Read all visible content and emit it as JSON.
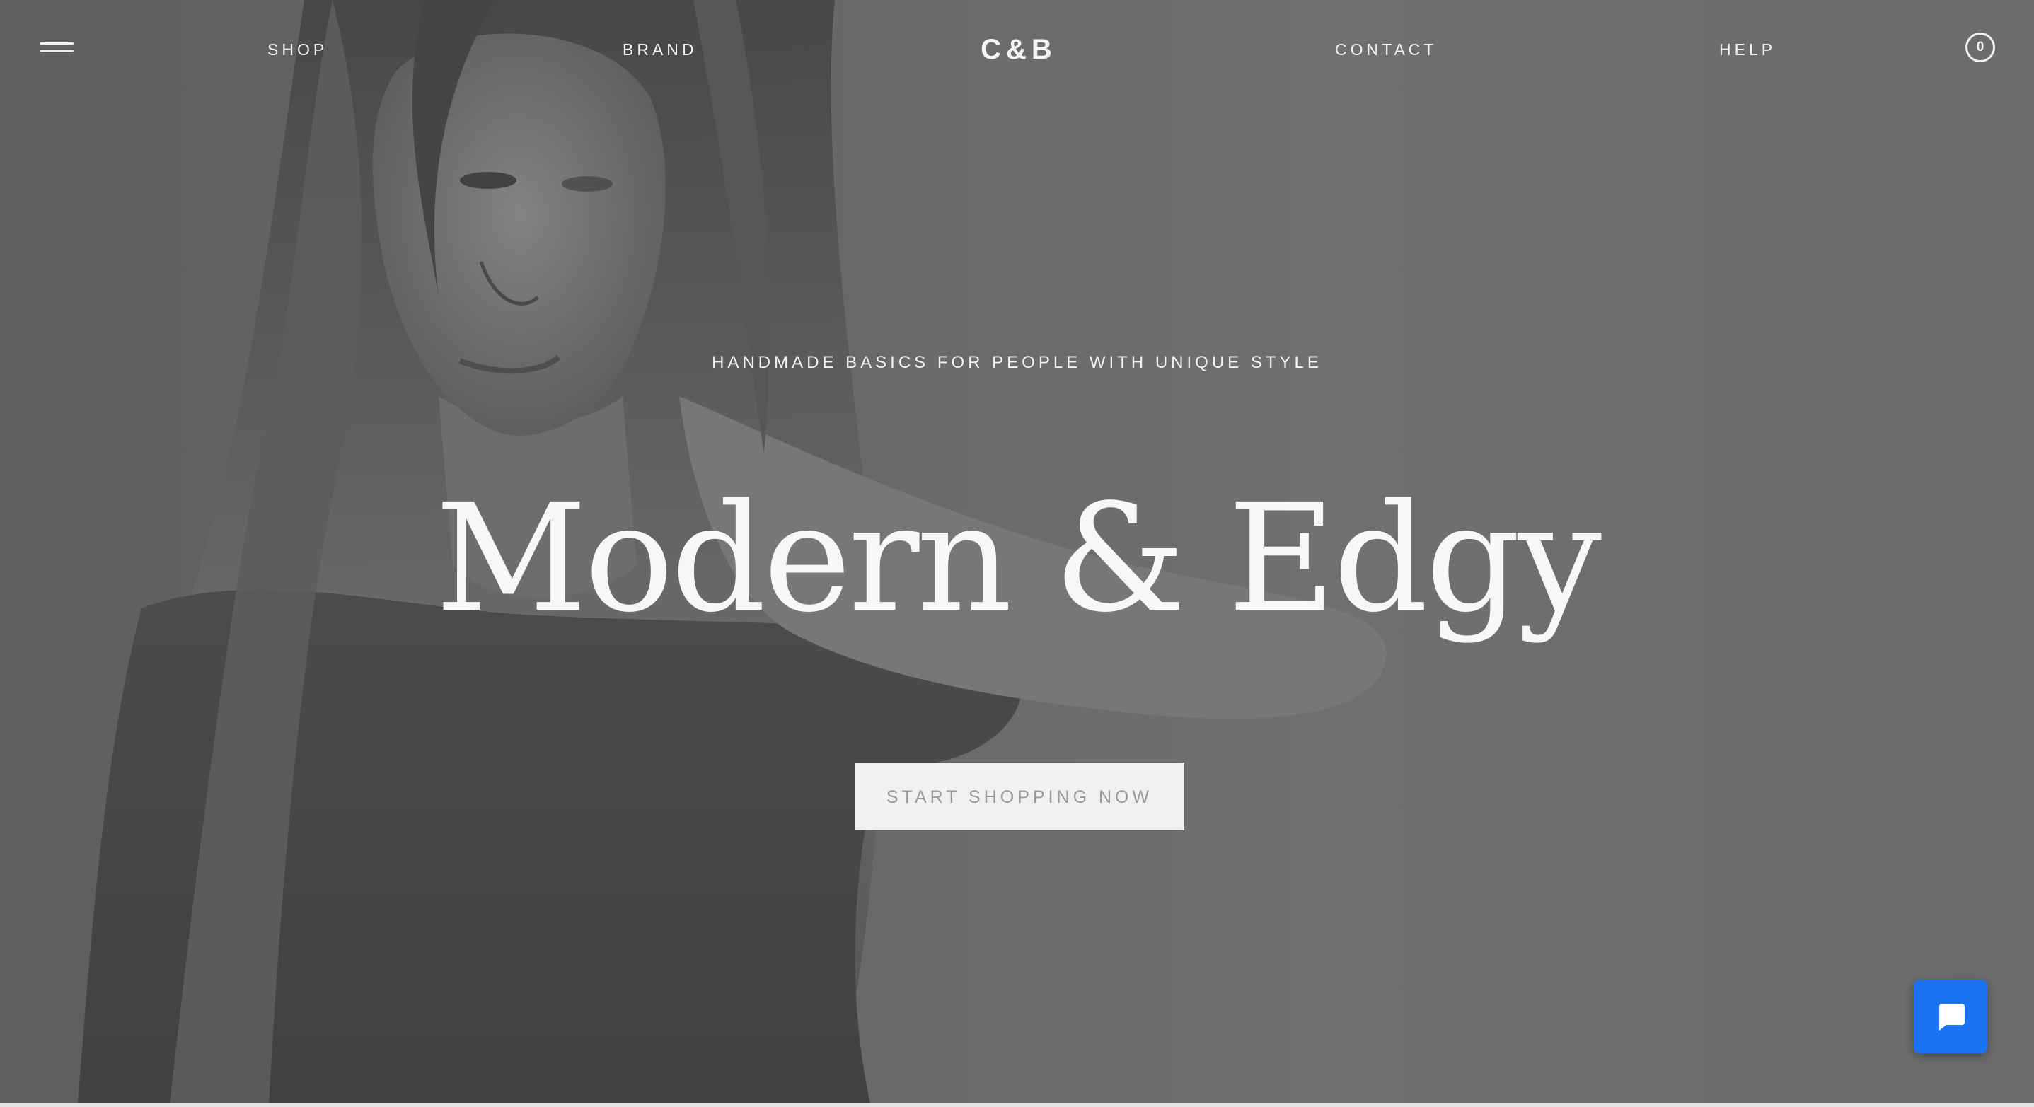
{
  "header": {
    "menu_icon": "hamburger-menu-icon",
    "nav_left": [
      {
        "label": "SHOP"
      },
      {
        "label": "BRAND"
      }
    ],
    "logo": "C&B",
    "nav_right": [
      {
        "label": "CONTACT"
      },
      {
        "label": "HELP"
      }
    ],
    "cart_count": "0"
  },
  "hero": {
    "tagline": "HANDMADE BASICS FOR PEOPLE WITH UNIQUE STYLE",
    "headline": "Modern & Edgy",
    "cta_label": "START SHOPPING NOW"
  },
  "chat": {
    "icon": "chat-bubble-icon",
    "color": "#1a74f2"
  },
  "colors": {
    "background": "#6b6b6b",
    "text": "#f4f4f4",
    "cta_background": "#f1f1f1",
    "cta_text": "#9a9a9a"
  }
}
